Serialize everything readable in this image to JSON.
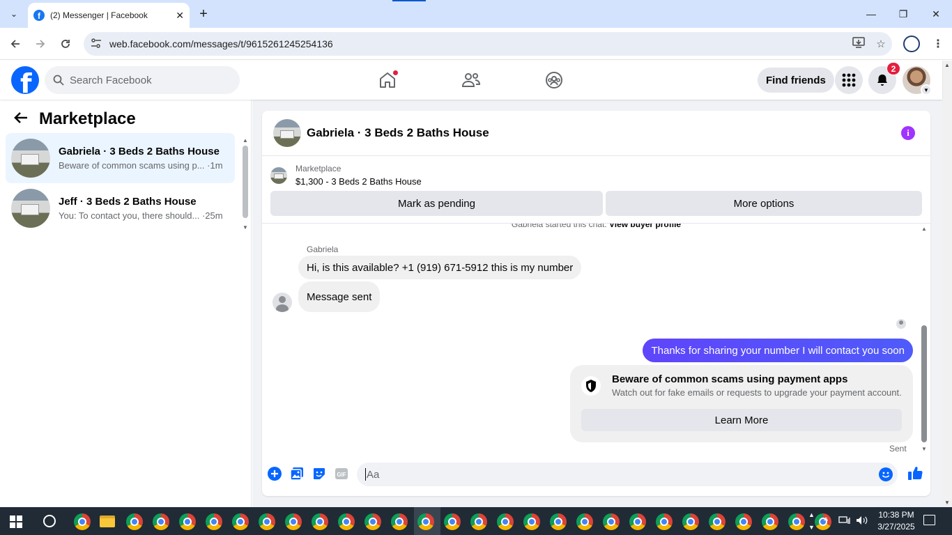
{
  "browser": {
    "tab_title": "(2) Messenger | Facebook",
    "tab_close": "✕",
    "new_tab": "+",
    "url": "web.facebook.com/messages/t/9615261245254136",
    "window_controls": {
      "minimize": "—",
      "restore": "❐",
      "close": "✕"
    },
    "icons": [
      "tab-search-icon",
      "back-icon",
      "forward-icon",
      "reload-icon",
      "site-info-icon",
      "install-app-icon",
      "bookmark-star-icon",
      "profile-icon",
      "more-menu-icon"
    ]
  },
  "fb_header": {
    "logo": "f",
    "search_placeholder": "Search Facebook",
    "find_friends": "Find friends",
    "notification_count": "2",
    "nav_icons": [
      "home-icon",
      "friends-icon",
      "groups-icon"
    ]
  },
  "left_panel": {
    "title": "Marketplace",
    "conversations": [
      {
        "name": "Gabriela · 3 Beds 2 Baths House",
        "preview": "Beware of common scams using p... ·1m",
        "active": true
      },
      {
        "name": "Jeff · 3 Beds 2 Baths House",
        "preview": "You: To contact you, there should... ·25m",
        "active": false
      }
    ]
  },
  "chat": {
    "title": "Gabriela · 3 Beds 2 Baths House",
    "listing_label": "Marketplace",
    "listing_title": "$1,300 - 3 Beds 2 Baths House",
    "mark_pending": "Mark as pending",
    "more_options": "More options",
    "system_line_prefix": "Gabriela started this chat.",
    "system_line_link": "View buyer profile",
    "sender_name": "Gabriela",
    "incoming": [
      "Hi, is this available? +1 (919) 671-5912 this is my number",
      "Message sent"
    ],
    "outgoing": "Thanks for sharing your number I will contact you soon",
    "scam_card": {
      "title": "Beware of common scams using payment apps",
      "subtitle": "Watch out for fake emails or requests to upgrade your payment account.",
      "button": "Learn More"
    },
    "status": "Sent",
    "composer_placeholder": "Aa",
    "composer_icons": [
      "add-icon",
      "photo-icon",
      "sticker-icon",
      "gif-icon",
      "emoji-icon",
      "like-icon"
    ],
    "gif_label": "GIF"
  },
  "taskbar": {
    "time": "10:38 PM",
    "date": "3/27/2025"
  },
  "colors": {
    "fb_blue": "#0866ff",
    "outgoing_bubble": "#5b47fb",
    "active_convo": "#ebf5ff",
    "badge_red": "#e41e3f",
    "info_purple": "#a033ff"
  }
}
